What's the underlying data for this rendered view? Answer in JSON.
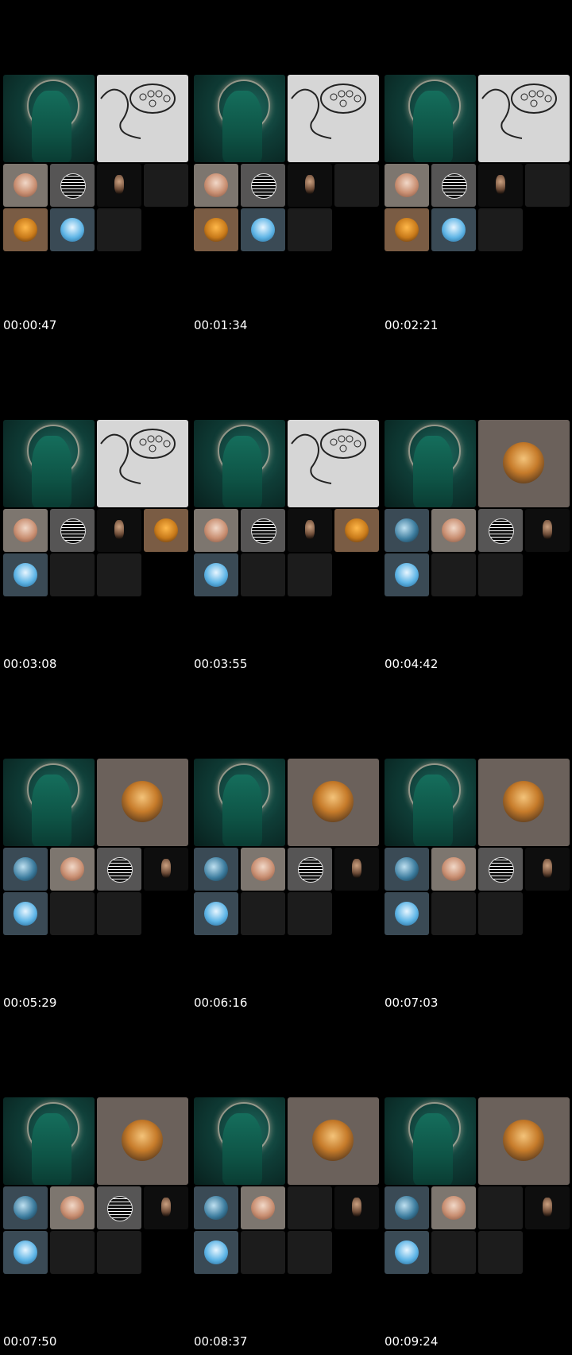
{
  "frames": [
    {
      "timestamp": "00:00:47"
    },
    {
      "timestamp": "00:01:34"
    },
    {
      "timestamp": "00:02:21"
    },
    {
      "timestamp": "00:03:08"
    },
    {
      "timestamp": "00:03:55"
    },
    {
      "timestamp": "00:04:42"
    },
    {
      "timestamp": "00:05:29"
    },
    {
      "timestamp": "00:06:16"
    },
    {
      "timestamp": "00:07:03"
    },
    {
      "timestamp": "00:07:50"
    },
    {
      "timestamp": "00:08:37"
    },
    {
      "timestamp": "00:09:24"
    }
  ],
  "colors": {
    "background": "#000000",
    "text": "#ffffff",
    "tile_empty": "#1c1c1c"
  }
}
